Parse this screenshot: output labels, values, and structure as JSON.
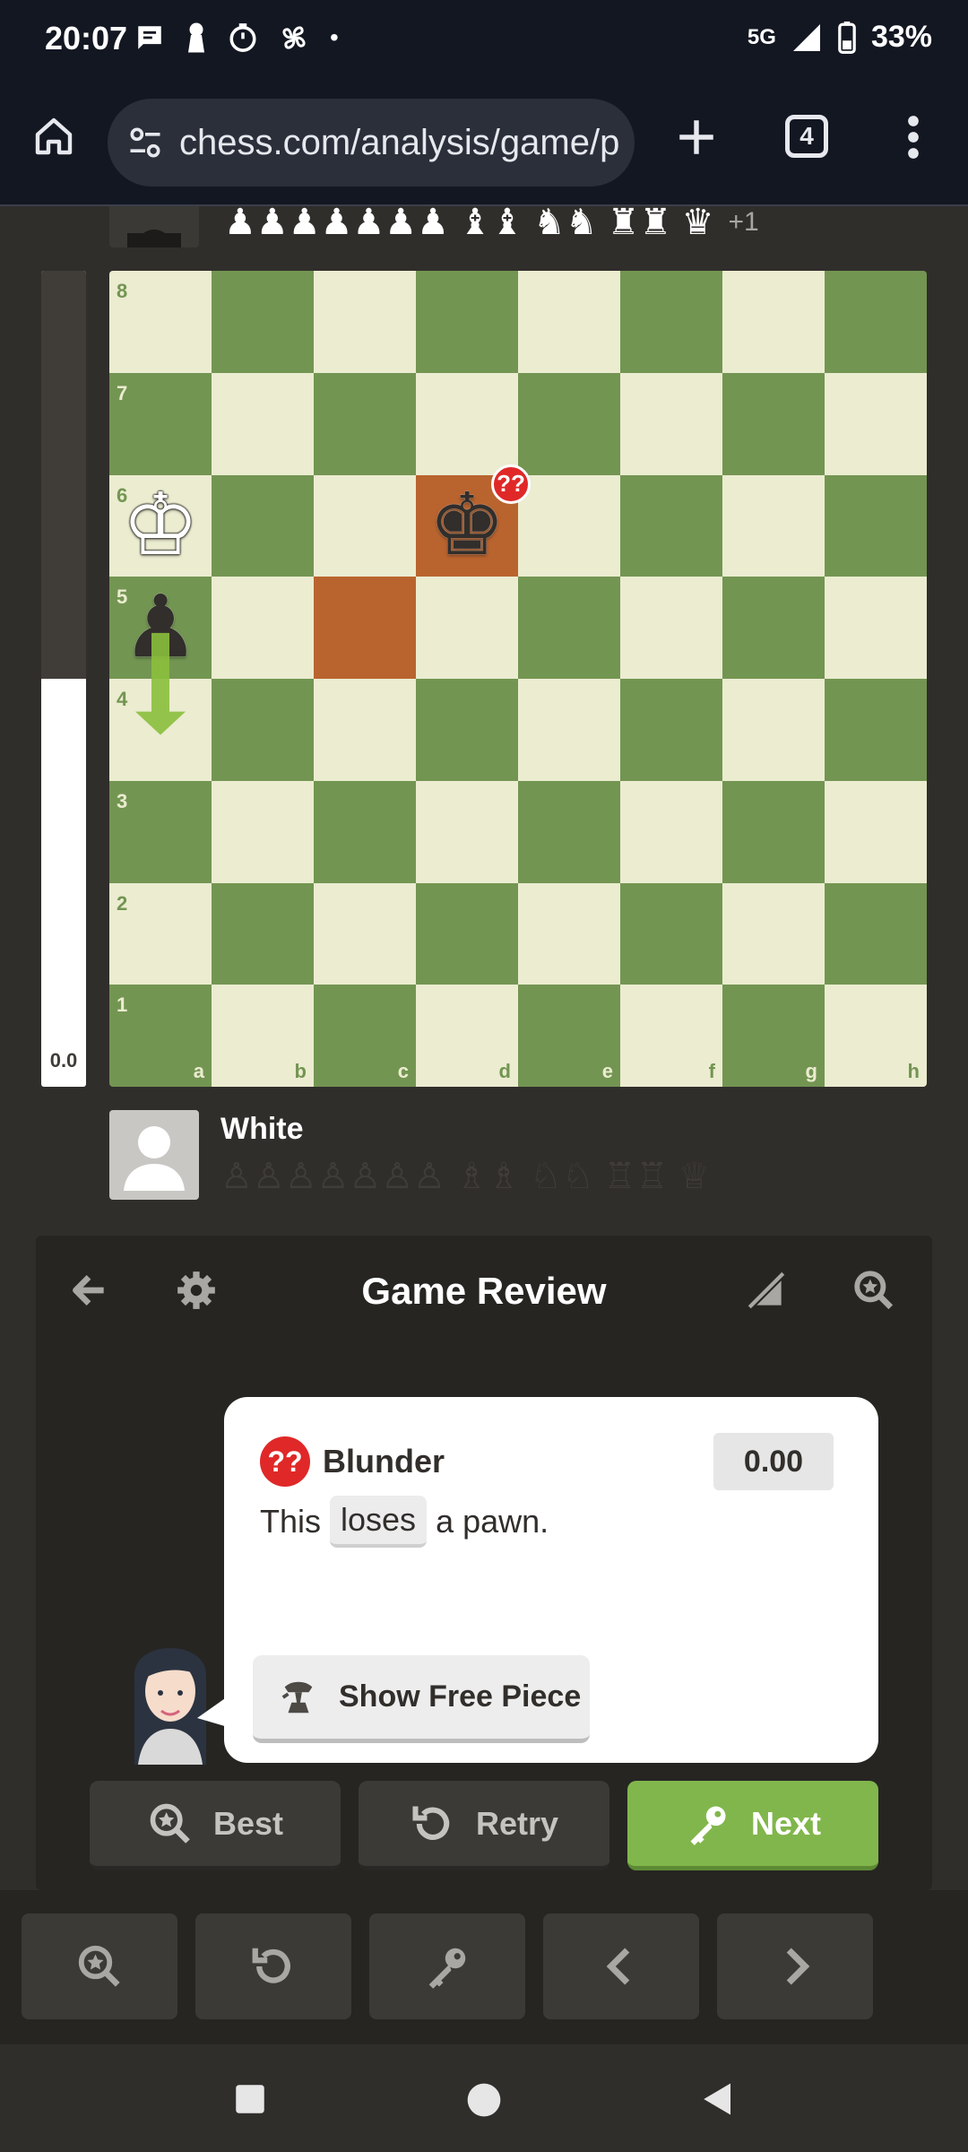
{
  "status_bar": {
    "time": "20:07",
    "network": "5G",
    "battery": "33%",
    "dot": "•"
  },
  "browser": {
    "url": "chess.com/analysis/game/p",
    "tab_count": "4"
  },
  "top_player": {
    "captured_pieces": "♟♟♟♟♟♟♟ ♝♝ ♞♞ ♜♜ ♛",
    "material_diff": "+1"
  },
  "eval_bar": {
    "value": "0.0",
    "white_fraction": 0.5
  },
  "board": {
    "ranks": [
      "8",
      "7",
      "6",
      "5",
      "4",
      "3",
      "2",
      "1"
    ],
    "files": [
      "a",
      "b",
      "c",
      "d",
      "e",
      "f",
      "g",
      "h"
    ],
    "pieces": [
      {
        "square": "a6",
        "glyph": "♔",
        "color": "white",
        "name": "white-king"
      },
      {
        "square": "d6",
        "glyph": "♚",
        "color": "black",
        "name": "black-king"
      },
      {
        "square": "a5",
        "glyph": "♟",
        "color": "black",
        "name": "black-pawn"
      }
    ],
    "highlighted_squares": [
      "c5",
      "d6"
    ],
    "blunder_badge": "??",
    "arrow": {
      "from": "a5",
      "to": "a4",
      "color": "#8bbf3c"
    }
  },
  "bottom_player": {
    "name": "White",
    "captured_pieces": "♙♙♙♙♙♙♙ ♗♗ ♘♘ ♖♖ ♕"
  },
  "review": {
    "title": "Game Review",
    "classification_icon": "??",
    "classification": "Blunder",
    "eval": "0.00",
    "desc_before": "This",
    "desc_chip": "loses",
    "desc_after": "a pawn.",
    "show_free_piece": "Show Free Piece"
  },
  "actions": {
    "best": "Best",
    "retry": "Retry",
    "next": "Next"
  },
  "colors": {
    "light_square": "#ebecd0",
    "dark_square": "#739552",
    "highlight": "#b9642f",
    "blunder": "#e02828",
    "next_button": "#81b64c"
  }
}
